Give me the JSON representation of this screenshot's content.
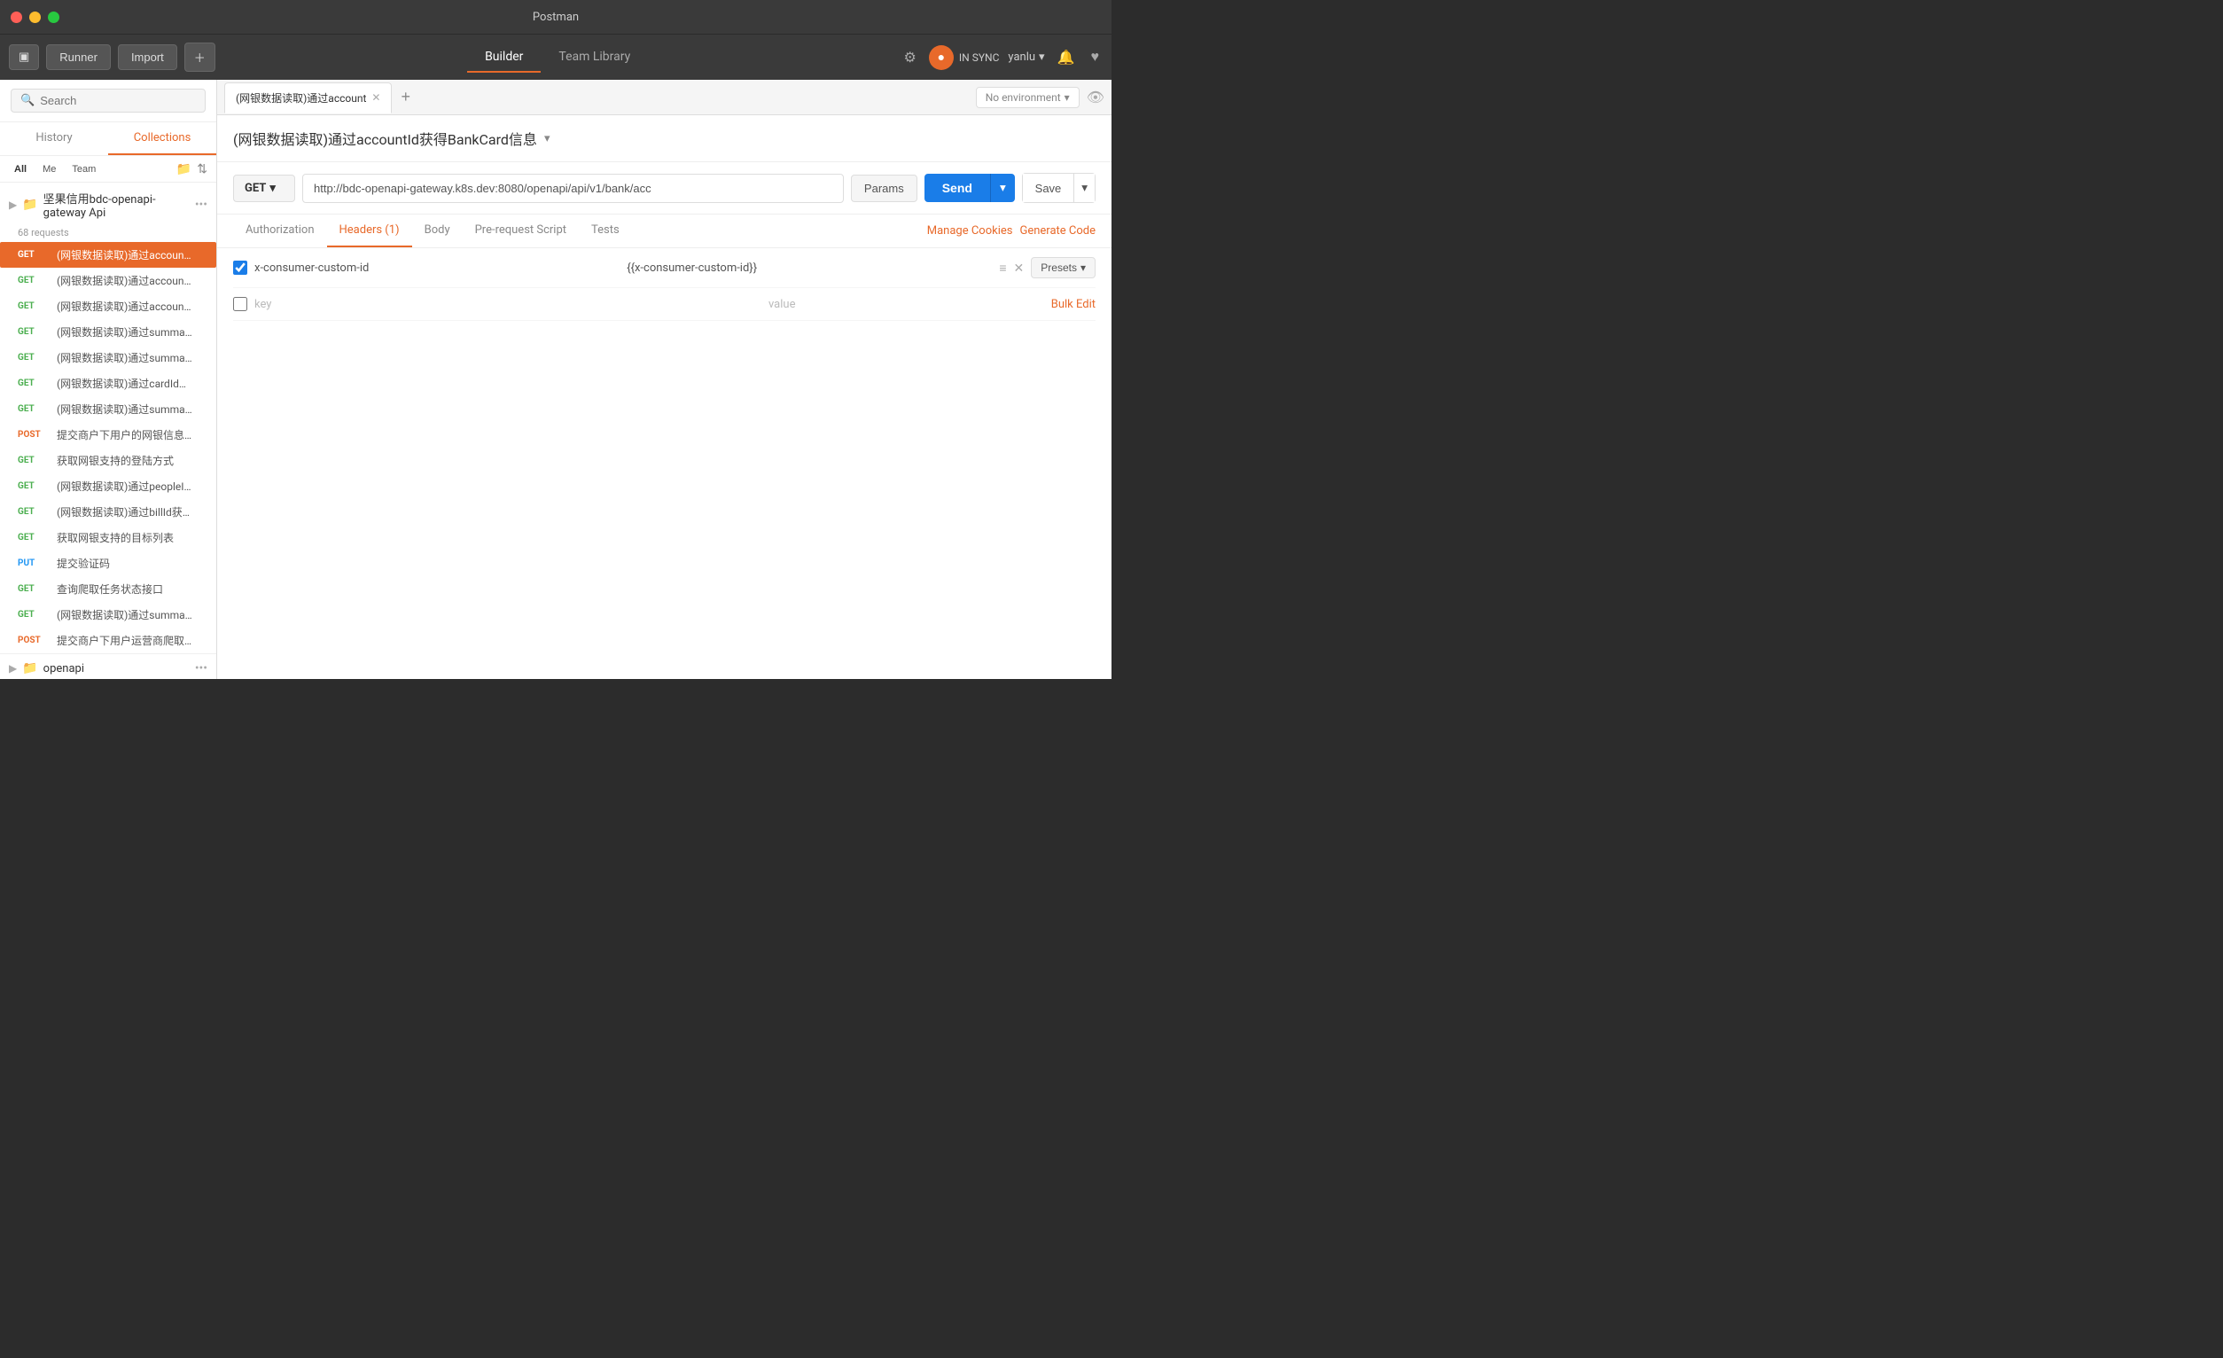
{
  "window": {
    "title": "Postman"
  },
  "toolbar": {
    "runner_label": "Runner",
    "import_label": "Import",
    "builder_tab": "Builder",
    "team_library_tab": "Team Library",
    "sync_label": "IN SYNC",
    "user_label": "yanlu",
    "sidebar_icon": "▣"
  },
  "left_panel": {
    "search_placeholder": "Search",
    "history_tab": "History",
    "collections_tab": "Collections",
    "filter_all": "All",
    "filter_me": "Me",
    "filter_team": "Team",
    "collections": [
      {
        "id": "jigu",
        "name": "坚果信用bdc-openapi-gateway Api",
        "count": "68 requests",
        "expanded": true
      },
      {
        "id": "openapi",
        "name": "openapi",
        "count": "",
        "expanded": false
      }
    ],
    "requests": [
      {
        "method": "GET",
        "name": "(网银数据读取)通过accountId获得BankCard信息",
        "active": true
      },
      {
        "method": "GET",
        "name": "(网银数据读取)通过accountId查询账户信息",
        "active": false
      },
      {
        "method": "GET",
        "name": "(网银数据读取)通过accountId查询个人银行卡信...",
        "active": false
      },
      {
        "method": "GET",
        "name": "(网银数据读取)通过summaryId获得BankBill列...",
        "active": false
      },
      {
        "method": "GET",
        "name": "(网银数据读取)通过summaryId获得BankCard列...",
        "active": false
      },
      {
        "method": "GET",
        "name": "(网银数据读取)通过cardId获得BankCard信息",
        "active": false
      },
      {
        "method": "GET",
        "name": "(网银数据读取)通过summaryId获得BankBillSu...",
        "active": false
      },
      {
        "method": "POST",
        "name": "提交商户下用户的网银信息抓取任务",
        "active": false
      },
      {
        "method": "GET",
        "name": "获取网银支持的登陆方式",
        "active": false
      },
      {
        "method": "GET",
        "name": "(网银数据读取)通过peopleId获得people信息",
        "active": false
      },
      {
        "method": "GET",
        "name": "(网银数据读取)通过billId获得BankShoppingRec...",
        "active": false
      },
      {
        "method": "GET",
        "name": "获取网银支持的目标列表",
        "active": false
      },
      {
        "method": "PUT",
        "name": "提交验证码",
        "active": false
      },
      {
        "method": "GET",
        "name": "查询爬取任务状态接口",
        "active": false
      },
      {
        "method": "GET",
        "name": "(网银数据读取)通过summaryId获得银行账单摘...",
        "active": false
      },
      {
        "method": "POST",
        "name": "提交商户下用户运营商爬取任务",
        "active": false
      }
    ]
  },
  "right_panel": {
    "active_tab": "(网银数据读取)通过account",
    "add_tab_icon": "+",
    "env_placeholder": "No environment",
    "request_title": "(网银数据读取)通过accountId获得BankCard信息",
    "method": "GET",
    "url": "http://bdc-openapi-gateway.k8s.dev:8080/openapi/api/v1/bank/acc",
    "params_label": "Params",
    "send_label": "Send",
    "save_label": "Save",
    "option_tabs": [
      {
        "label": "Authorization",
        "active": false
      },
      {
        "label": "Headers (1)",
        "active": true
      },
      {
        "label": "Body",
        "active": false
      },
      {
        "label": "Pre-request Script",
        "active": false
      },
      {
        "label": "Tests",
        "active": false
      }
    ],
    "manage_cookies": "Manage Cookies",
    "generate_code": "Generate Code",
    "headers": [
      {
        "enabled": true,
        "key": "x-consumer-custom-id",
        "value": "{{x-consumer-custom-id}}"
      },
      {
        "enabled": false,
        "key": "",
        "value": ""
      }
    ],
    "key_placeholder": "key",
    "value_placeholder": "value",
    "bulk_edit": "Bulk Edit",
    "presets_label": "Presets"
  }
}
